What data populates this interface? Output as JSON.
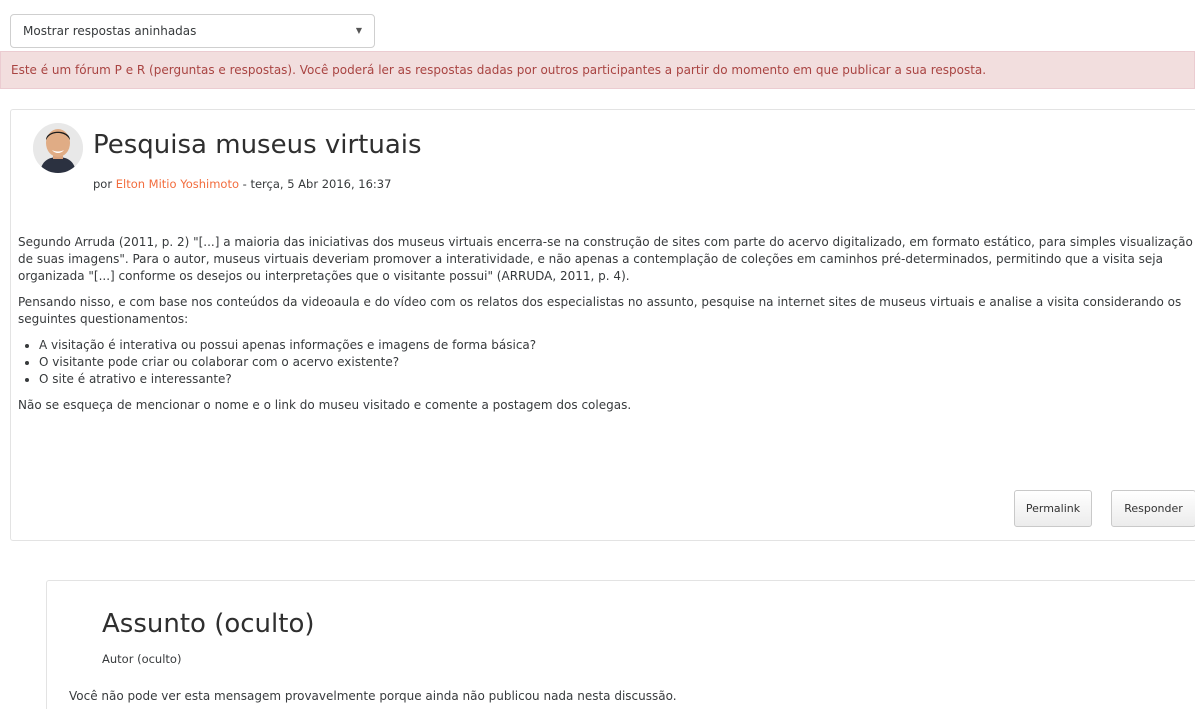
{
  "display_mode": {
    "selected": "Mostrar respostas aninhadas"
  },
  "alert": {
    "text": "Este é um fórum P e R (perguntas e respostas). Você poderá ler as respostas dadas por outros participantes a partir do momento em que publicar a sua resposta."
  },
  "post": {
    "title": "Pesquisa museus virtuais",
    "by_prefix": "por ",
    "author": "Elton Mitio Yoshimoto",
    "date": " - terça, 5 Abr 2016, 16:37",
    "paragraph1": "Segundo Arruda (2011, p. 2) \"[...] a maioria das iniciativas dos museus virtuais encerra-se na construção de sites com parte do acervo digitalizado, em formato estático, para simples visualização de suas imagens\". Para o autor, museus virtuais deveriam promover a interatividade, e não apenas a contemplação de coleções em caminhos pré-determinados, permitindo que a visita seja organizada \"[...] conforme os desejos ou interpretações que o visitante possui\" (ARRUDA, 2011, p. 4).",
    "paragraph2": "Pensando nisso, e com base nos conteúdos da videoaula e do vídeo com os relatos dos especialistas no assunto, pesquise na internet sites de museus virtuais e analise a visita considerando os seguintes questionamentos:",
    "questions": [
      "A visitação é interativa ou possui apenas informações e imagens de forma básica?",
      "O visitante pode criar ou colaborar com o acervo existente?",
      "O site é atrativo e interessante?"
    ],
    "paragraph3": "Não se esqueça de mencionar o nome e o link do museu visitado e comente a postagem dos colegas.",
    "permalink_label": "Permalink",
    "reply_label": "Responder"
  },
  "hidden_reply": {
    "title": "Assunto (oculto)",
    "author": "Autor (oculto)",
    "message": "Você não pode ver esta mensagem provavelmente porque ainda não publicou nada nesta discussão."
  }
}
